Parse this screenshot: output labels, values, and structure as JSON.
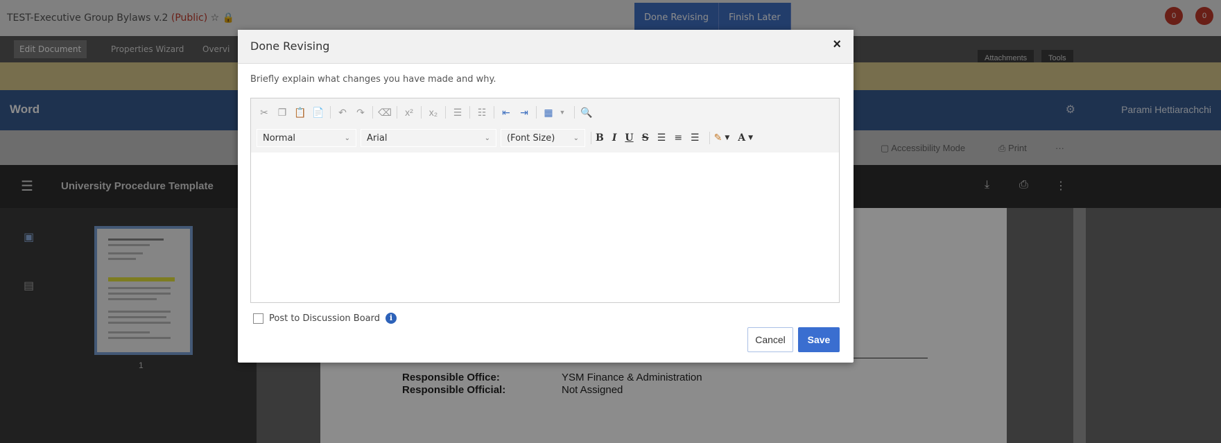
{
  "app": {
    "doc_title": "TEST-Executive Group Bylaws v.2",
    "doc_visibility": "(Public)",
    "top_buttons": [
      "Done Revising",
      "Finish Later"
    ],
    "notification_counts": [
      "0",
      "0"
    ],
    "tabs": [
      "Edit Document",
      "Properties Wizard",
      "Overvi"
    ],
    "right_tabs": [
      "Attachments",
      "Tools"
    ],
    "wordbar_title": "Word",
    "user_name": "Parami Hettiarachchi",
    "toolbar_items": [
      "Accessibility Mode",
      "Print",
      "···"
    ],
    "panel_title": "University Procedure Template",
    "page_number": "1",
    "doc_fields": [
      {
        "label": "Responsible Office:",
        "value": "YSM Finance & Administration"
      },
      {
        "label": "Responsible Official:",
        "value": "Not Assigned"
      }
    ]
  },
  "modal": {
    "title": "Done Revising",
    "close_glyph": "×",
    "instruction": "Briefly explain what changes you have made and why.",
    "toolbar_row1_icons": [
      "cut-icon",
      "copy-icon",
      "paste-icon",
      "paste-word-icon",
      "undo-icon",
      "redo-icon",
      "eraser-icon",
      "superscript-icon",
      "subscript-icon",
      "numbered-list-icon",
      "bulleted-list-icon",
      "outdent-icon",
      "indent-icon",
      "table-icon",
      "find-icon"
    ],
    "toolbar_row2_icons": [
      "bold-icon",
      "italic-icon",
      "underline-icon",
      "strikethrough-icon",
      "align-left-icon",
      "align-center-icon",
      "align-right-icon",
      "highlight-icon",
      "font-color-icon"
    ],
    "format_select": "Normal",
    "font_select": "Arial",
    "size_select": "(Font Size)",
    "editor_content": "",
    "post_label": "Post to Discussion Board",
    "post_checked": false,
    "cancel_label": "Cancel",
    "save_label": "Save"
  },
  "colors": {
    "accent": "#3a6ed0",
    "wordbar": "#385b91",
    "notice": "#d9c88d"
  }
}
